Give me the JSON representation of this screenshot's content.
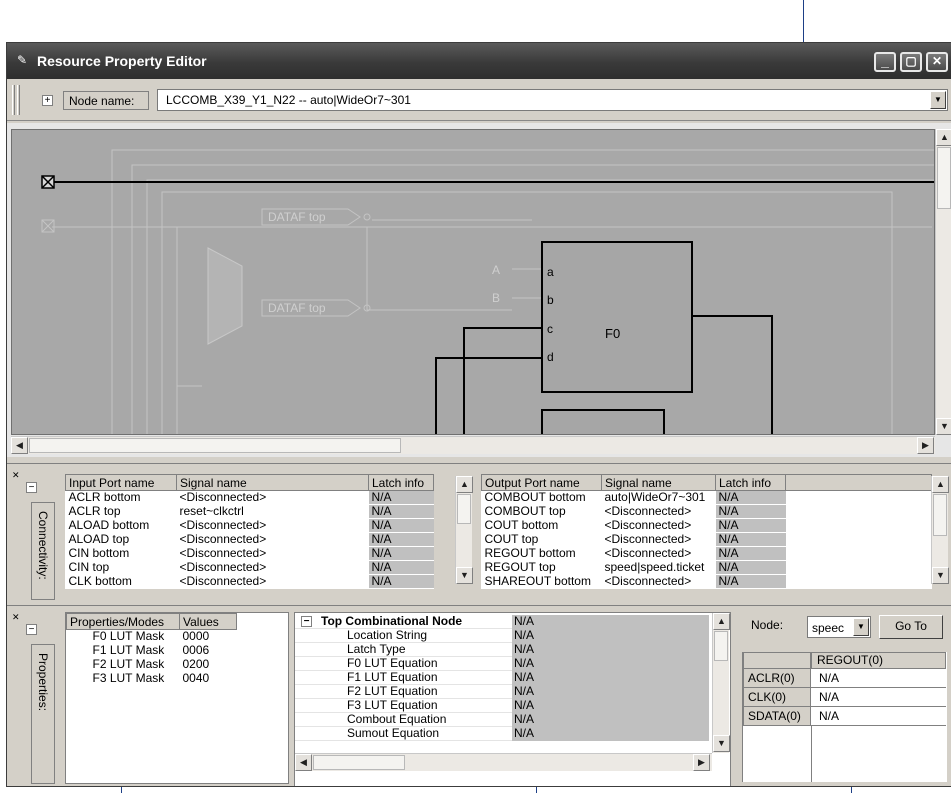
{
  "window": {
    "title": "Resource Property Editor",
    "controls": {
      "minimize": "_",
      "restore": "▢",
      "close": "✕"
    }
  },
  "node_bar": {
    "label": "Node name:",
    "value": "LCCOMB_X39_Y1_N22 -- auto|WideOr7~301"
  },
  "diagram": {
    "ports": [
      "A",
      "B"
    ],
    "lut_pins": [
      "a",
      "b",
      "c",
      "d"
    ],
    "lut_name": "F0",
    "dataf_labels": [
      "DATAF top",
      "DATAF top"
    ],
    "colors": {
      "background": "#a8a8a8",
      "signal": "#000000",
      "faded": "#cfcfcf"
    }
  },
  "connectivity": {
    "tab_label": "Connectivity:",
    "inputs": {
      "headers": [
        "Input Port name",
        "Signal name",
        "Latch info"
      ],
      "rows": [
        [
          "ACLR bottom",
          "<Disconnected>",
          "N/A"
        ],
        [
          "ACLR top",
          "reset~clkctrl",
          "N/A"
        ],
        [
          "ALOAD bottom",
          "<Disconnected>",
          "N/A"
        ],
        [
          "ALOAD top",
          "<Disconnected>",
          "N/A"
        ],
        [
          "CIN bottom",
          "<Disconnected>",
          "N/A"
        ],
        [
          "CIN top",
          "<Disconnected>",
          "N/A"
        ],
        [
          "CLK bottom",
          "<Disconnected>",
          "N/A"
        ]
      ]
    },
    "outputs": {
      "headers": [
        "Output Port name",
        "Signal name",
        "Latch info"
      ],
      "rows": [
        [
          "COMBOUT bottom",
          "auto|WideOr7~301",
          "N/A"
        ],
        [
          "COMBOUT top",
          "<Disconnected>",
          "N/A"
        ],
        [
          "COUT bottom",
          "<Disconnected>",
          "N/A"
        ],
        [
          "COUT top",
          "<Disconnected>",
          "N/A"
        ],
        [
          "REGOUT bottom",
          "<Disconnected>",
          "N/A"
        ],
        [
          "REGOUT top",
          "speed|speed.ticket",
          "N/A"
        ],
        [
          "SHAREOUT bottom",
          "<Disconnected>",
          "N/A"
        ]
      ]
    }
  },
  "properties": {
    "tab_label": "Properties:",
    "headers": [
      "Properties/Modes",
      "Values"
    ],
    "rows": [
      [
        "F0 LUT Mask",
        "0000"
      ],
      [
        "F1 LUT Mask",
        "0006"
      ],
      [
        "F2 LUT Mask",
        "0200"
      ],
      [
        "F3 LUT Mask",
        "0040"
      ]
    ],
    "tree": {
      "root_label": "Top Combinational Node",
      "root_value": "N/A",
      "items": [
        [
          "Location String",
          "N/A"
        ],
        [
          "Latch Type",
          "N/A"
        ],
        [
          "F0 LUT Equation",
          "N/A"
        ],
        [
          "F1 LUT Equation",
          "N/A"
        ],
        [
          "F2 LUT Equation",
          "N/A"
        ],
        [
          "F3 LUT Equation",
          "N/A"
        ],
        [
          "Combout Equation",
          "N/A"
        ],
        [
          "Sumout Equation",
          "N/A"
        ]
      ]
    },
    "node_lookup": {
      "label": "Node:",
      "combo_value": "speec",
      "goto_label": "Go To",
      "column_header": "REGOUT(0)",
      "rows": [
        [
          "ACLR(0)",
          "N/A"
        ],
        [
          "CLK(0)",
          "N/A"
        ],
        [
          "SDATA(0)",
          "N/A"
        ]
      ]
    }
  },
  "icons": [
    "window-icon",
    "expand-icon",
    "collapse-icon",
    "close-panel-icon",
    "dropdown-arrow-icon",
    "scroll-up-icon",
    "scroll-down-icon",
    "scroll-left-icon",
    "scroll-right-icon"
  ]
}
